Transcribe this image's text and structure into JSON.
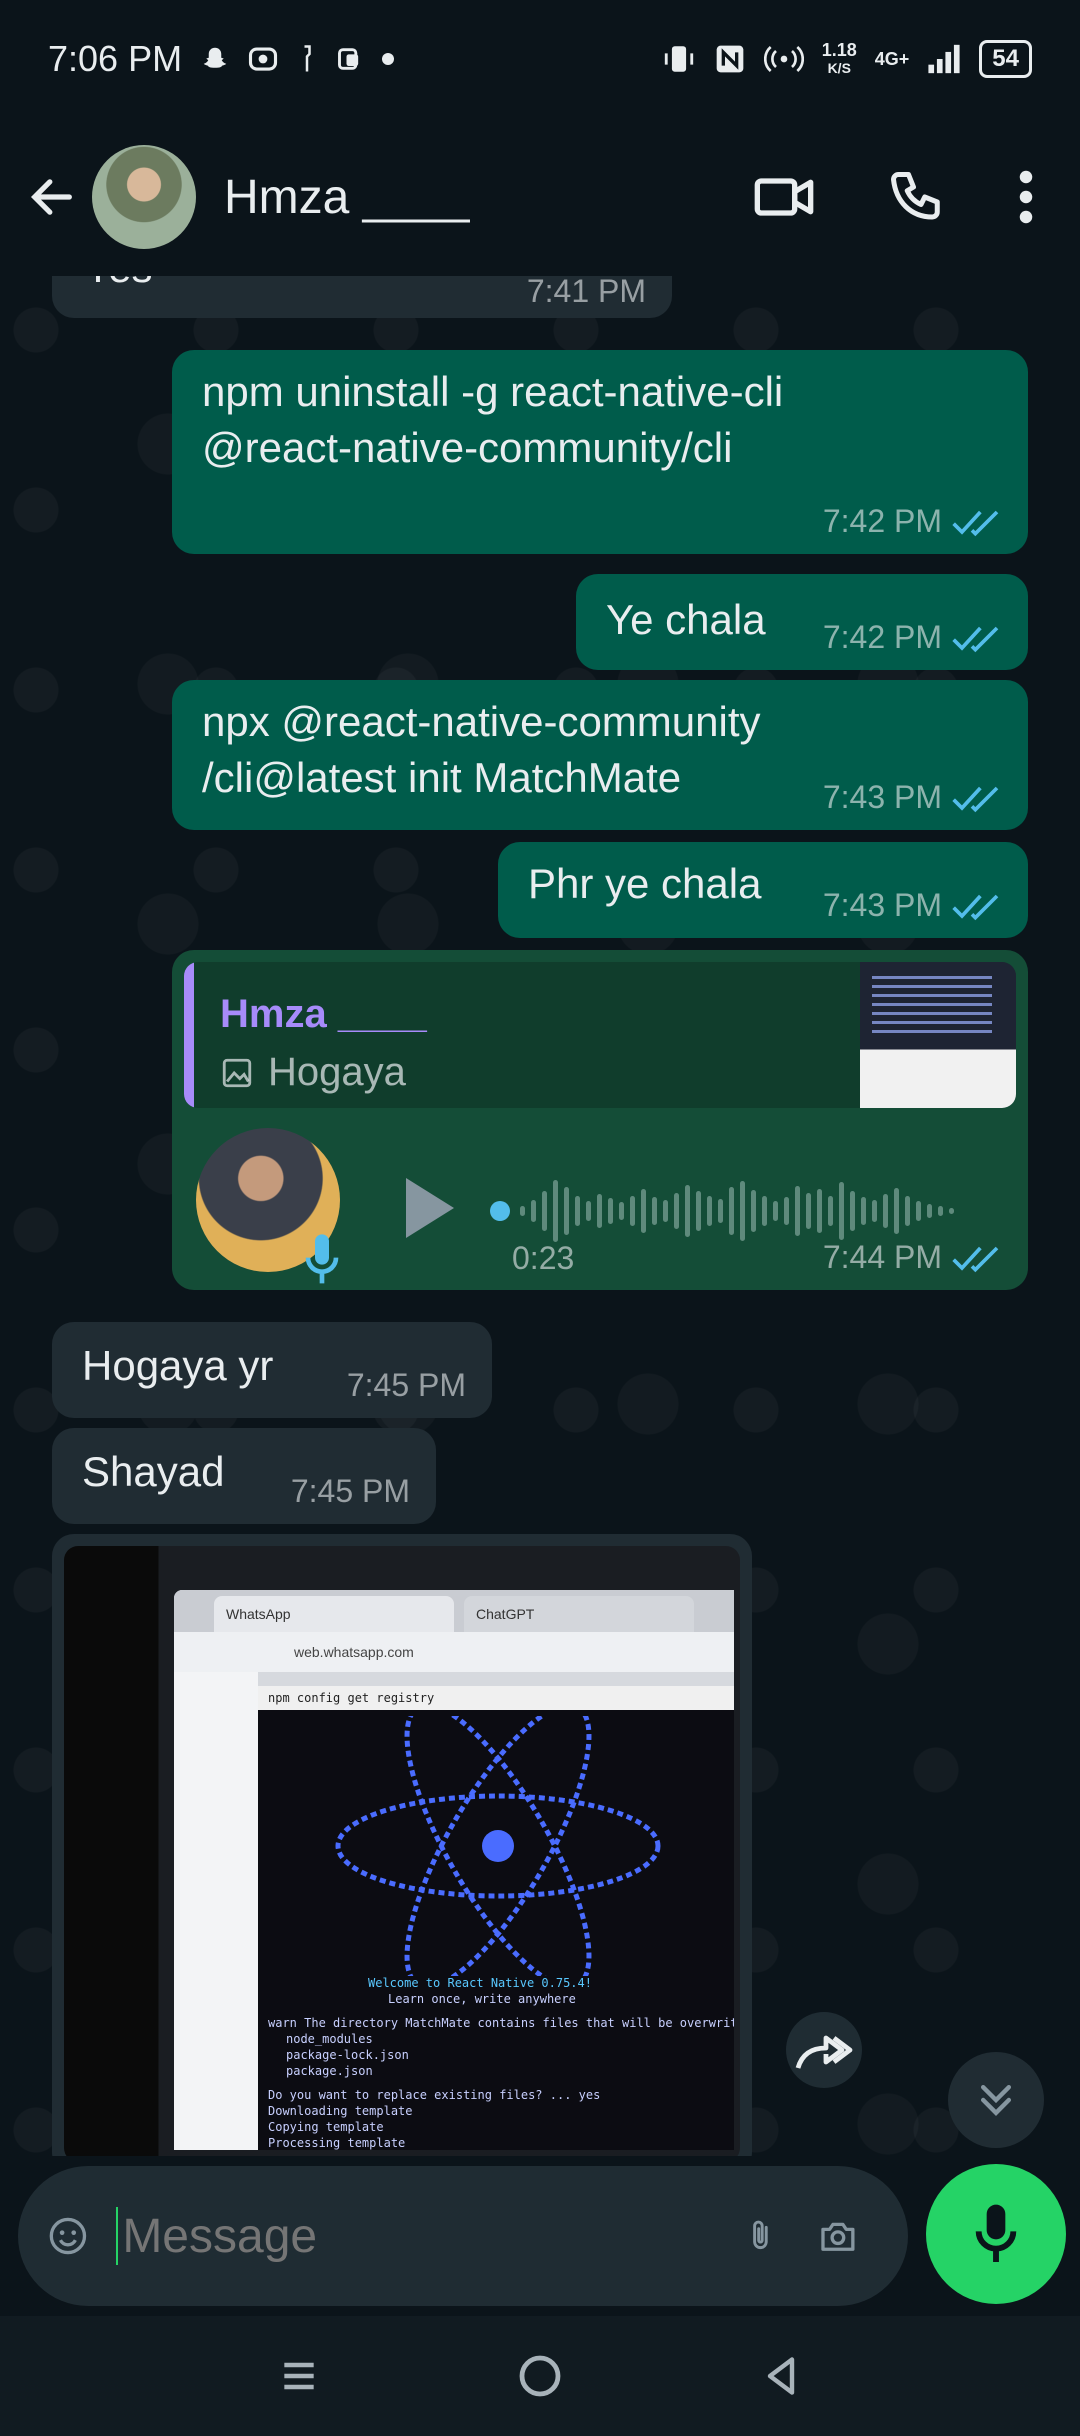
{
  "status_bar": {
    "time": "7:06 PM",
    "net_speed_value": "1.18",
    "net_speed_unit": "K/S",
    "network": "4G+",
    "battery": "54"
  },
  "header": {
    "contact_name": "Hmza ____"
  },
  "messages": {
    "partial_top": {
      "text": "Yes",
      "time": "7:41 PM"
    },
    "m1": {
      "text": "npm uninstall -g react-native-cli @react-native-community/cli",
      "time": "7:42 PM"
    },
    "m2": {
      "text": "Ye chala",
      "time": "7:42 PM"
    },
    "m3": {
      "text": "npx @react-native-community /cli@latest init MatchMate",
      "time": "7:43 PM"
    },
    "m4": {
      "text": "Phr ye chala",
      "time": "7:43 PM"
    },
    "voice": {
      "quote_name": "Hmza ____",
      "quote_text": "Hogaya",
      "duration": "0:23",
      "time": "7:44 PM"
    },
    "m5": {
      "text": "Hogaya yr",
      "time": "7:45 PM"
    },
    "m6": {
      "text": "Shayad",
      "time": "7:45 PM"
    }
  },
  "image_message": {
    "tab1": "WhatsApp",
    "tab2": "ChatGPT",
    "url": "web.whatsapp.com",
    "terminal_title": "npm config get registry",
    "welcome": "Welcome to React Native 0.75.4!",
    "tagline": "Learn once, write anywhere",
    "warn": "warn The directory MatchMate contains files that will be overwritt",
    "file1": "node_modules",
    "file2": "package-lock.json",
    "file3": "package.json",
    "question": "Do you want to replace existing files? ... yes",
    "step1": "Downloading template",
    "step2": "Copying template",
    "step3": "Processing template"
  },
  "composer": {
    "placeholder": "Message"
  },
  "colors": {
    "outgoing_bubble": "#005c4b",
    "incoming_bubble": "#202c33",
    "accent": "#25d366",
    "read_ticks": "#53bdeb"
  }
}
